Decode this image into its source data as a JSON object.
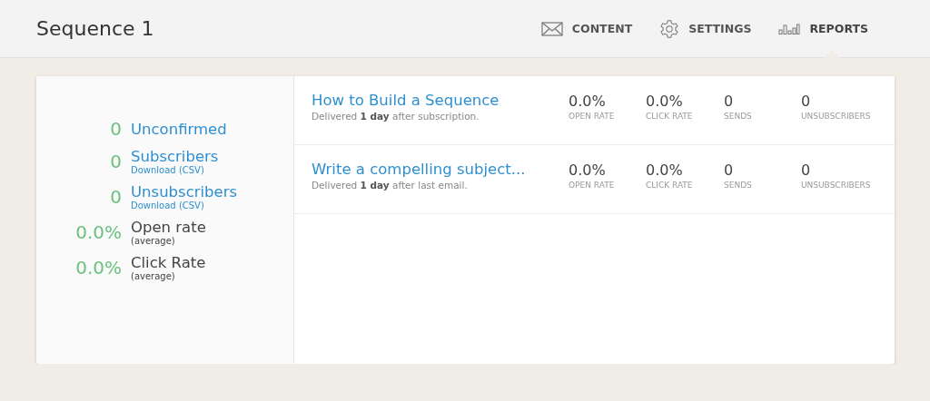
{
  "header": {
    "title": "Sequence 1"
  },
  "nav": [
    {
      "label": "CONTENT",
      "selected": false
    },
    {
      "label": "SETTINGS",
      "selected": false
    },
    {
      "label": "REPORTS",
      "selected": true
    }
  ],
  "summary": [
    {
      "kind": "link",
      "value": "0",
      "label": "Unconfirmed"
    },
    {
      "kind": "link",
      "value": "0",
      "label": "Subscribers",
      "sublabel": "Download (CSV)"
    },
    {
      "kind": "link",
      "value": "0",
      "label": "Unsubscribers",
      "sublabel": "Download (CSV)"
    },
    {
      "kind": "average",
      "value": "0.0%",
      "label": "Open rate",
      "sublabel": "(average)"
    },
    {
      "kind": "average",
      "value": "0.0%",
      "label": "Click Rate",
      "sublabel": "(average)"
    }
  ],
  "emails": [
    {
      "title": "How to Build a Sequence",
      "description": "Delivered **1 day** after subscription.",
      "stats": [
        {
          "value": "0.0%",
          "label": "OPEN RATE"
        },
        {
          "value": "0.0%",
          "label": "CLICK RATE"
        },
        {
          "value": "0",
          "label": "SENDS"
        },
        {
          "value": "0",
          "label": "UNSUBSCRIBERS"
        }
      ]
    },
    {
      "title": "Write a compelling subject...",
      "description": "Delivered **1 day** after last email.",
      "stats": [
        {
          "value": "0.0%",
          "label": "OPEN RATE"
        },
        {
          "value": "0.0%",
          "label": "CLICK RATE"
        },
        {
          "value": "0",
          "label": "SENDS"
        },
        {
          "value": "0",
          "label": "UNSUBSCRIBERS"
        }
      ]
    }
  ]
}
